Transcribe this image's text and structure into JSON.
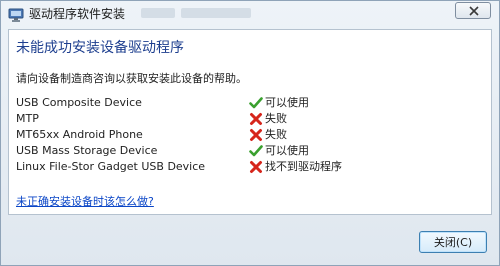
{
  "window": {
    "title": "驱动程序软件安装"
  },
  "main": {
    "heading": "未能成功安装设备驱动程序",
    "description": "请向设备制造商咨询以获取安装此设备的帮助。",
    "devices": [
      {
        "name": "USB Composite Device",
        "status": "可以使用",
        "icon": "check-icon"
      },
      {
        "name": "MTP",
        "status": "失败",
        "icon": "cross-icon"
      },
      {
        "name": "MT65xx Android Phone",
        "status": "失败",
        "icon": "cross-icon"
      },
      {
        "name": "USB Mass Storage Device",
        "status": "可以使用",
        "icon": "check-icon"
      },
      {
        "name": "Linux File-Stor Gadget USB Device",
        "status": "找不到驱动程序",
        "icon": "cross-icon"
      }
    ],
    "help_link": "未正确安装设备时该怎么做?"
  },
  "footer": {
    "close_label": "关闭(C)"
  },
  "colors": {
    "heading": "#1e3f8f",
    "link": "#0b46c7",
    "success": "#3aa02f",
    "failure": "#d6251b"
  }
}
